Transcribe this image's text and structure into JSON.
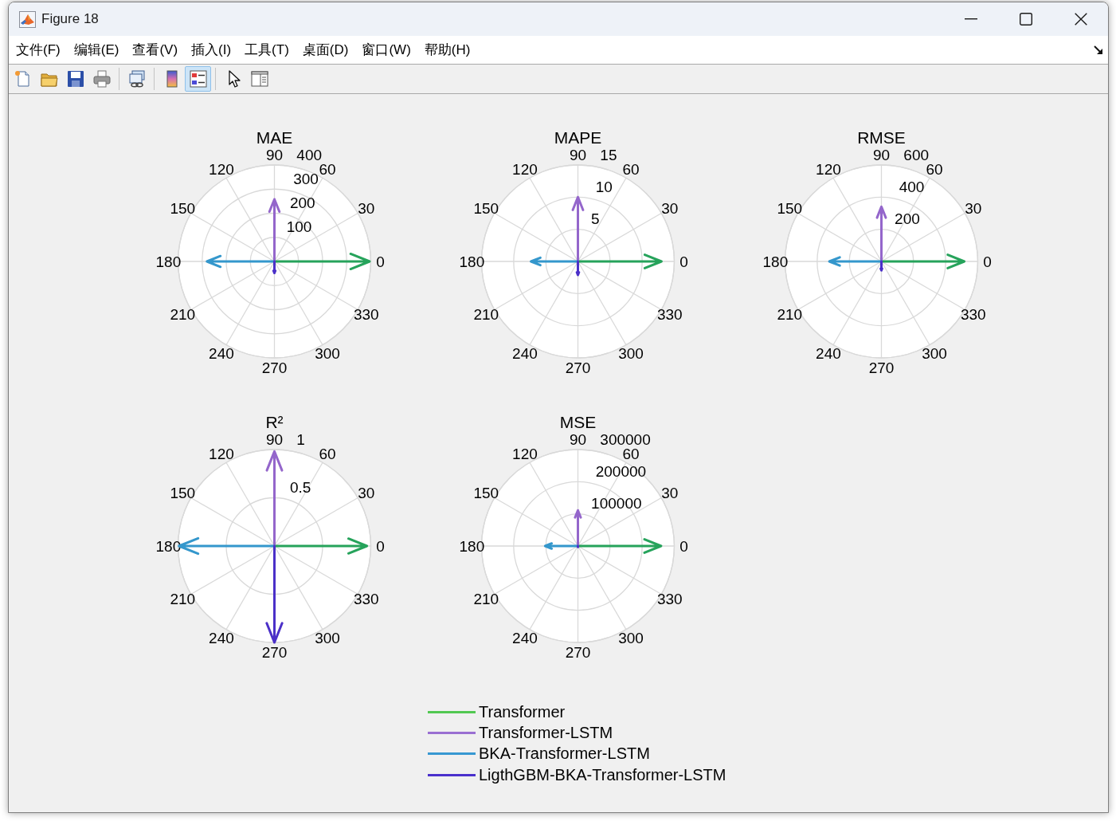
{
  "window": {
    "title": "Figure 18"
  },
  "menu": [
    "文件(F)",
    "编辑(E)",
    "查看(V)",
    "插入(I)",
    "工具(T)",
    "桌面(D)",
    "窗口(W)",
    "帮助(H)"
  ],
  "toolbar": {
    "groups": [
      {
        "buttons": [
          {
            "pressed": false
          },
          {
            "pressed": false
          },
          {
            "pressed": false
          },
          {
            "pressed": false
          }
        ]
      },
      {
        "buttons": [
          {
            "pressed": false
          }
        ]
      },
      {
        "buttons": [
          {
            "pressed": false
          },
          {
            "pressed": true
          }
        ]
      },
      {
        "buttons": [
          {
            "pressed": false
          },
          {
            "pressed": false
          }
        ]
      }
    ]
  },
  "plots": [
    {
      "title": "MAE",
      "angle_labels": [
        "0",
        "30",
        "60",
        "90",
        "120",
        "150",
        "180",
        "210",
        "240",
        "270",
        "300",
        "330"
      ],
      "radius_labels": [
        "400",
        "300",
        "200",
        "100"
      ],
      "arrows": [
        {
          "color": "#26a35b"
        },
        {
          "color": "#9466cb"
        },
        {
          "color": "#3497cc"
        },
        {
          "color": "#4b30c8"
        }
      ]
    },
    {
      "title": "MAPE",
      "angle_labels": [
        "0",
        "30",
        "60",
        "90",
        "120",
        "150",
        "180",
        "210",
        "240",
        "270",
        "300",
        "330"
      ],
      "radius_labels": [
        "15",
        "10",
        "5"
      ],
      "arrows": [
        {
          "color": "#26a35b"
        },
        {
          "color": "#9466cb"
        },
        {
          "color": "#3497cc"
        },
        {
          "color": "#4b30c8"
        }
      ]
    },
    {
      "title": "RMSE",
      "angle_labels": [
        "0",
        "30",
        "60",
        "90",
        "120",
        "150",
        "180",
        "210",
        "240",
        "270",
        "300",
        "330"
      ],
      "radius_labels": [
        "600",
        "400",
        "200"
      ],
      "arrows": [
        {
          "color": "#26a35b"
        },
        {
          "color": "#9466cb"
        },
        {
          "color": "#3497cc"
        },
        {
          "color": "#4b30c8"
        }
      ]
    },
    {
      "title": "R²",
      "angle_labels": [
        "0",
        "30",
        "60",
        "90",
        "120",
        "150",
        "180",
        "210",
        "240",
        "270",
        "300",
        "330"
      ],
      "radius_labels": [
        "1",
        "0.5"
      ],
      "arrows": [
        {
          "color": "#26a35b"
        },
        {
          "color": "#9466cb"
        },
        {
          "color": "#3497cc"
        },
        {
          "color": "#4b30c8"
        }
      ]
    },
    {
      "title": "MSE",
      "angle_labels": [
        "0",
        "30",
        "60",
        "90",
        "120",
        "150",
        "180",
        "210",
        "240",
        "270",
        "300",
        "330"
      ],
      "radius_labels": [
        "300000",
        "200000",
        "100000"
      ],
      "arrows": [
        {
          "color": "#26a35b"
        },
        {
          "color": "#9466cb"
        },
        {
          "color": "#3497cc"
        },
        {
          "color": "#4b30c8"
        }
      ]
    }
  ],
  "legend": {
    "items": [
      {
        "label": "Transformer",
        "color": "#52c852"
      },
      {
        "label": "Transformer-LSTM",
        "color": "#9a6fd2"
      },
      {
        "label": "BKA-Transformer-LSTM",
        "color": "#3798d2"
      },
      {
        "label": "LigthGBM-BKA-Transformer-LSTM",
        "color": "#4a30cc"
      }
    ]
  }
}
